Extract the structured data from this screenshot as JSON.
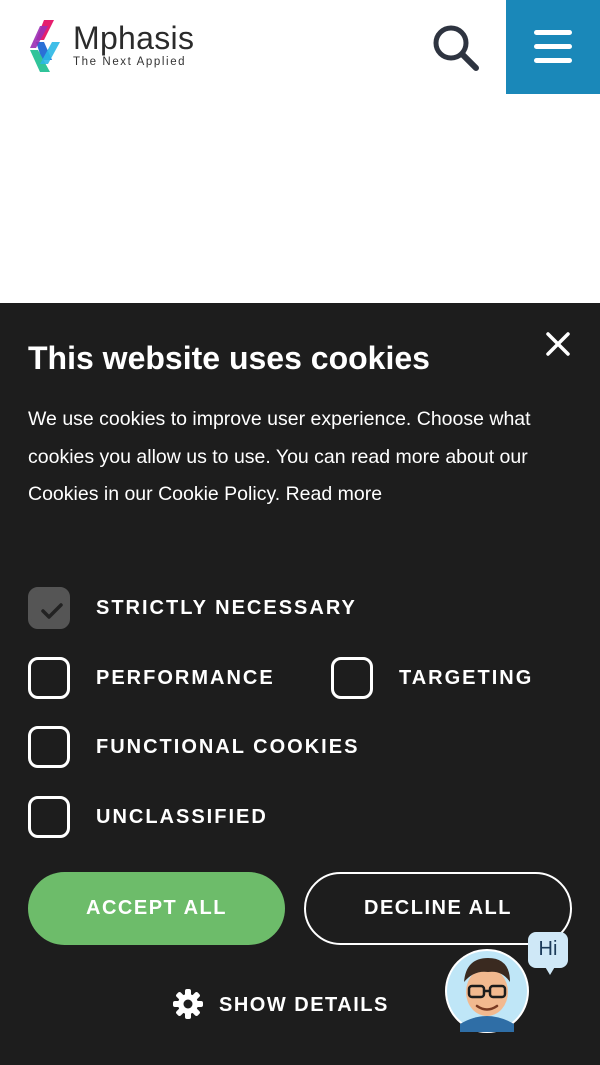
{
  "header": {
    "brand_name": "Mphasis",
    "brand_tagline": "The Next Applied",
    "search_icon": "search-icon",
    "menu_icon": "hamburger-menu-icon",
    "menu_bg_color": "#1a88b9"
  },
  "cookie_banner": {
    "title": "This website uses cookies",
    "description": "We use cookies to improve user experience. Choose what cookies you allow us to use. You can read more about our Cookies in our Cookie Policy.",
    "read_more": "Read more",
    "close_icon": "close-icon",
    "categories": [
      {
        "label": "STRICTLY NECESSARY",
        "checked": true
      },
      {
        "label": "PERFORMANCE",
        "checked": false
      },
      {
        "label": "TARGETING",
        "checked": false
      },
      {
        "label": "FUNCTIONAL COOKIES",
        "checked": false
      },
      {
        "label": "UNCLASSIFIED",
        "checked": false
      }
    ],
    "accept_label": "ACCEPT ALL",
    "decline_label": "DECLINE ALL",
    "show_details_label": "SHOW DETAILS",
    "show_details_icon": "gear-icon",
    "panel_bg_color": "#1d1d1d",
    "accept_color": "#6dbc6a"
  },
  "chatbot": {
    "greeting": "Hi",
    "avatar_icon": "chatbot-avatar-icon"
  }
}
